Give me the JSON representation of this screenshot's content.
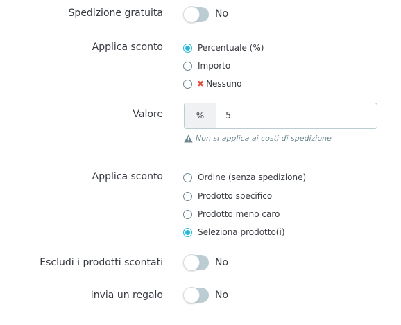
{
  "free_shipping": {
    "label": "Spedizione gratuita",
    "value": "No",
    "enabled": false
  },
  "apply_discount": {
    "label": "Applica sconto",
    "options": [
      {
        "label": "Percentuale (%)",
        "checked": true
      },
      {
        "label": "Importo",
        "checked": false
      },
      {
        "label": "Nessuno",
        "checked": false,
        "icon": "x-icon"
      }
    ]
  },
  "value": {
    "label": "Valore",
    "addon": "%",
    "input_value": "5",
    "help_text": "Non si applica ai costi di spedizione",
    "help_icon": "warning-icon"
  },
  "apply_discount_to": {
    "label": "Applica sconto",
    "options": [
      {
        "label": "Ordine (senza spedizione)",
        "checked": false
      },
      {
        "label": "Prodotto specifico",
        "checked": false
      },
      {
        "label": "Prodotto meno caro",
        "checked": false
      },
      {
        "label": "Seleziona prodotto(i)",
        "checked": true
      }
    ]
  },
  "exclude_discounted": {
    "label": "Escludi i prodotti scontati",
    "value": "No",
    "enabled": false
  },
  "send_gift": {
    "label": "Invia un regalo",
    "value": "No",
    "enabled": false
  },
  "colors": {
    "accent": "#25b9d7",
    "switch_off": "#bbcdd2",
    "error": "#e54c3c",
    "muted": "#6c868e"
  }
}
